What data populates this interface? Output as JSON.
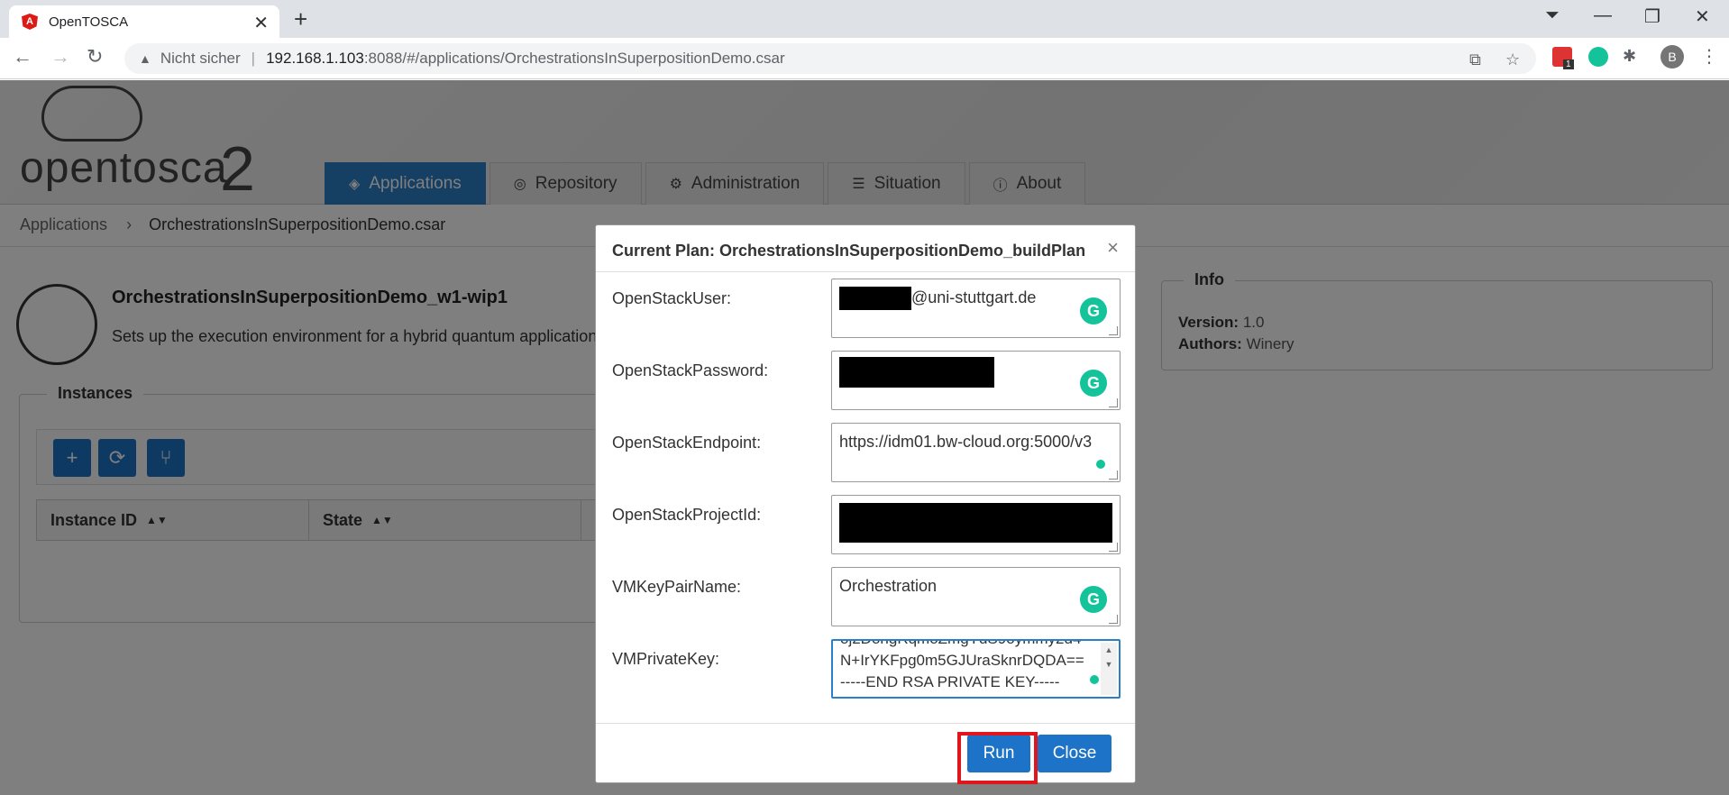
{
  "browser": {
    "tab_title": "OpenTOSCA",
    "tab_close": "✕",
    "new_tab": "+",
    "url_security": "Nicht sicher",
    "url_separator": "|",
    "url_host": "192.168.1.103",
    "url_path": ":8088/#/applications/OrchestrationsInSuperpositionDemo.csar",
    "profile_initial": "B",
    "extension_badge": "1"
  },
  "header": {
    "logo_text": "opentosca",
    "logo_number": "2",
    "nav": [
      {
        "label": "Applications",
        "icon": "layers-icon",
        "active": true
      },
      {
        "label": "Repository",
        "icon": "repository-icon"
      },
      {
        "label": "Administration",
        "icon": "gears-icon"
      },
      {
        "label": "Situation",
        "icon": "list-icon"
      },
      {
        "label": "About",
        "icon": "info-icon"
      }
    ]
  },
  "breadcrumb": {
    "root": "Applications",
    "current": "OrchestrationsInSuperpositionDemo.csar"
  },
  "app": {
    "title": "OrchestrationsInSuperpositionDemo_w1-wip1",
    "description": "Sets up the execution environment for a hybrid quantum application"
  },
  "instances": {
    "legend": "Instances",
    "columns": [
      "Instance ID",
      "State"
    ]
  },
  "info": {
    "legend": "Info",
    "version_label": "Version:",
    "version": "1.0",
    "authors_label": "Authors:",
    "authors": "Winery"
  },
  "modal": {
    "title": "Current Plan: OrchestrationsInSuperpositionDemo_buildPlan",
    "close_x": "×",
    "fields": [
      {
        "label": "OpenStackUser:",
        "value": "@uni-stuttgart.de"
      },
      {
        "label": "OpenStackPassword:",
        "value": ""
      },
      {
        "label": "OpenStackEndpoint:",
        "value": "https://idm01.bw-cloud.org:5000/v3"
      },
      {
        "label": "OpenStackProjectId:",
        "value": ""
      },
      {
        "label": "VMKeyPairName:",
        "value": "Orchestration"
      },
      {
        "label": "VMPrivateKey:",
        "lines": [
          "N+IrYKFpg0m5GJUraSknrDQDA==",
          "-----END RSA PRIVATE KEY-----"
        ]
      }
    ],
    "run_label": "Run",
    "close_label": "Close"
  },
  "colors": {
    "primary": "#1c73c7",
    "highlight": "#e2141c",
    "grammarly": "#15c39a"
  }
}
